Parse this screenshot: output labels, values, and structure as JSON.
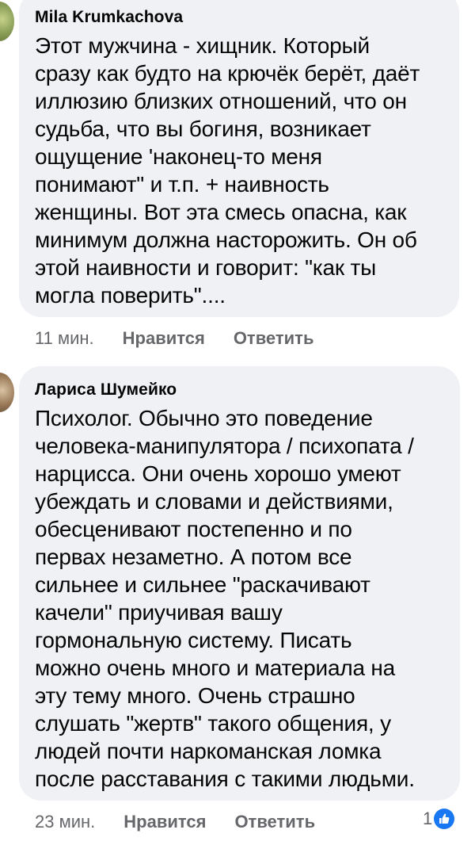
{
  "comments": [
    {
      "author": "Mila Krumkachova",
      "text": "Этот мужчина -  хищник. Который\nсразу как будто на крючёк берёт, даёт\nиллюзию близких отношений, что он\nсудьба, что вы богиня, возникает\nощущение 'наконец-то меня\nпонимают\" и т.п. + наивность\nженщины. Вот эта смесь опасна, как\nминимум должна насторожить. Он об\nэтой наивности  и говорит: \"как ты\nмогла поверить\"....",
      "time": "11 мин.",
      "like_label": "Нравится",
      "reply_label": "Ответить"
    },
    {
      "author": "Лариса Шумейко",
      "text": "Психолог. Обычно это поведение\nчеловека-манипулятора / психопата /\nнарцисса. Они очень хорошо умеют\nубеждать и словами и действиями,\nобесценивают постепенно и по\nпервах незаметно. А потом все\nсильнее и сильнее \"раскачивают\nкачели\" приучивая вашу\nгормональную систему. Писать\nможно очень много и материала на\nэту тему много.  Очень страшно\nслушать \"жертв\" такого общения, у\nлюдей почти наркоманская ломка\nпосле расставания с такими людьми.",
      "time": "23 мин.",
      "like_label": "Нравится",
      "reply_label": "Ответить",
      "reaction_count": "1",
      "reaction_icon": "thumbs-up-icon"
    }
  ],
  "colors": {
    "bubble_bg": "#eff1f5",
    "text": "#050505",
    "meta": "#65676b",
    "like_blue": "#1877f2"
  }
}
